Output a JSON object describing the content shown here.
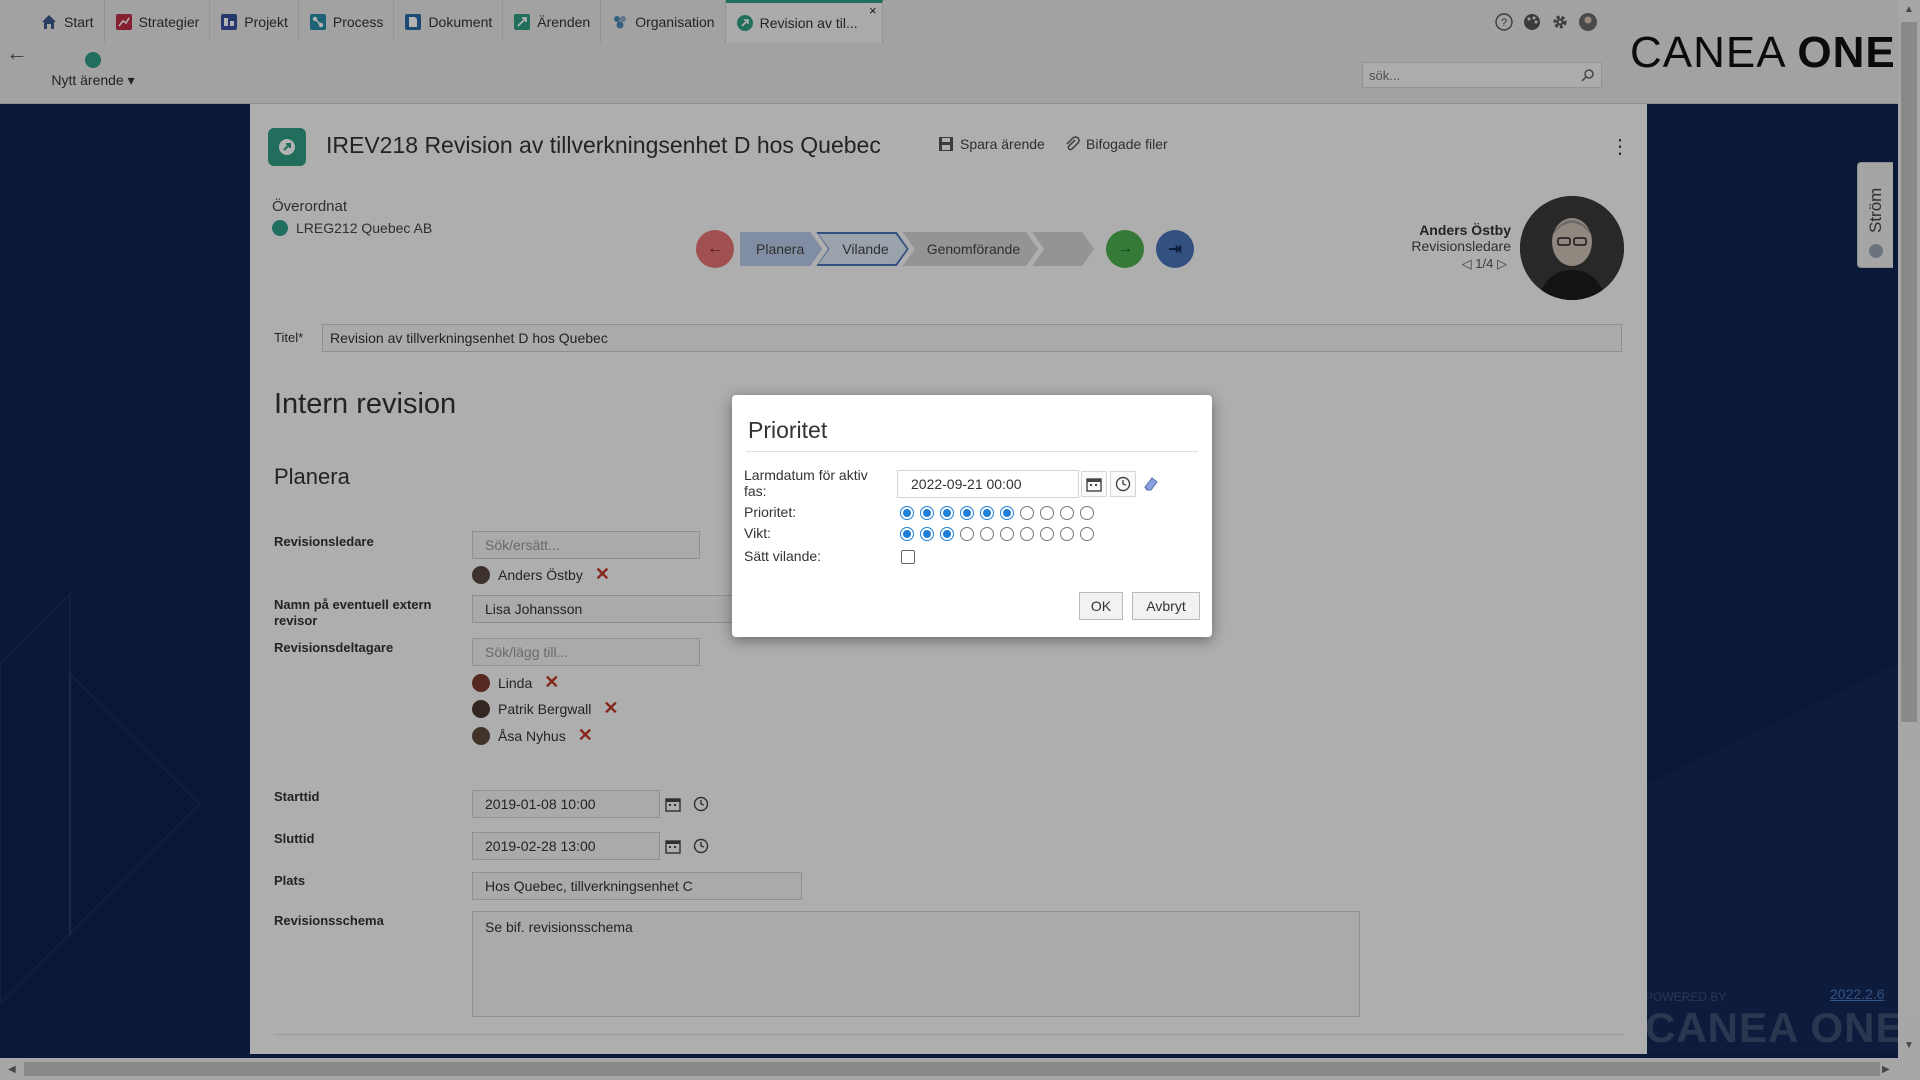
{
  "nav": {
    "tabs": [
      {
        "label": "Start",
        "icon": "home-icon"
      },
      {
        "label": "Strategier",
        "icon": "strategy-icon"
      },
      {
        "label": "Projekt",
        "icon": "project-icon"
      },
      {
        "label": "Process",
        "icon": "process-icon"
      },
      {
        "label": "Dokument",
        "icon": "document-icon"
      },
      {
        "label": "Ärenden",
        "icon": "case-icon"
      },
      {
        "label": "Organisation",
        "icon": "organization-icon"
      },
      {
        "label": "Revision av til...",
        "icon": "case-icon"
      }
    ],
    "close": "×",
    "new_case_label": "Nytt ärende",
    "search_placeholder": "sök...",
    "logo_light": "CANEA ",
    "logo_bold": "ONE"
  },
  "case": {
    "title": "IREV218 Revision av tillverkningsenhet D hos Quebec",
    "save_label": "Spara ärende",
    "attach_label": "Bifogade filer",
    "parent_label": "Överordnat",
    "parent_link": "LREG212 Quebec AB",
    "phases": [
      "Planera",
      "Vilande",
      "Genomförande",
      ""
    ],
    "active_phase": "Vilande",
    "person": {
      "name": "Anders Östby",
      "role": "Revisionsledare",
      "pager": "1/4"
    },
    "title_label": "Titel*",
    "title_value": "Revision av tillverkningsenhet D hos Quebec",
    "heading": "Intern revision",
    "subheading": "Planera"
  },
  "form": {
    "lead_label": "Revisionsledare",
    "lead_placeholder": "Sök/ersätt...",
    "lead_person": "Anders Östby",
    "external_label": "Namn på eventuell extern revisor",
    "external_value": "Lisa Johansson",
    "participants_label": "Revisionsdeltagare",
    "participants_placeholder": "Sök/lägg till...",
    "participants": [
      "Linda",
      "Patrik Bergwall",
      "Åsa Nyhus"
    ],
    "start_label": "Starttid",
    "start_value": "2019-01-08 10:00",
    "end_label": "Sluttid",
    "end_value": "2019-02-28 13:00",
    "place_label": "Plats",
    "place_value": "Hos Quebec, tillverkningsenhet C",
    "schema_label": "Revisionsschema",
    "schema_value": "Se bif. revisionsschema"
  },
  "modal": {
    "title": "Prioritet",
    "alarm_label": "Larmdatum för aktiv fas:",
    "alarm_value": "2022-09-21 00:00",
    "priority_label": "Prioritet:",
    "priority_level": 6,
    "weight_label": "Vikt:",
    "weight_level": 3,
    "scale_max": 10,
    "idle_label": "Sätt vilande:",
    "idle_checked": false,
    "ok_label": "OK",
    "cancel_label": "Avbryt"
  },
  "side": {
    "stream_label": "Ström",
    "version": "2022.2.6",
    "powered_by": "POWERED BY",
    "powered_logo": "CANEA ONE"
  },
  "colors": {
    "accent": "#2e9e83",
    "background": "#0d2352",
    "radio_on": "#1e7fd6",
    "remove": "#c0392b",
    "back_button": "#e57373",
    "forward_button": "#4caf50",
    "last_button": "#4a74b8",
    "phase_active": "#dde8f7",
    "phase_active_border": "#4a74b8",
    "phase_done": "#b9cbe8"
  }
}
